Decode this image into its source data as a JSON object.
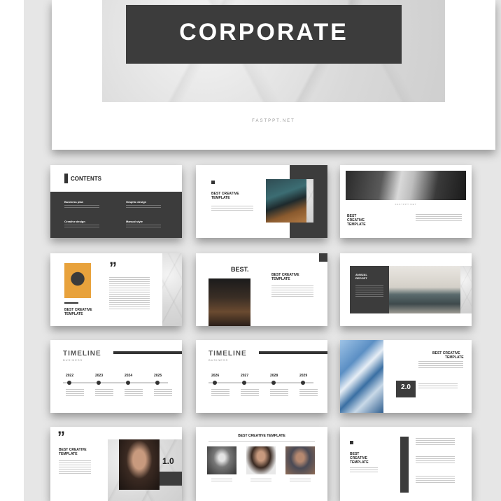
{
  "cover": {
    "title": "CORPORATE",
    "footer": "FASTPPT.NET"
  },
  "slides": {
    "contents": {
      "heading": "CONTENTS",
      "items": [
        "Business plan",
        "Graphic design",
        "Creative design",
        "Manual style"
      ]
    },
    "laptop": {
      "title_line1": "BEST CREATIVE",
      "title_line2": "TEMPLATE"
    },
    "keyboard": {
      "footer": "FASTPPT.NET",
      "title_line1": "BEST",
      "title_line2": "CREATIVE",
      "title_line3": "TEMPLATE"
    },
    "quote": {
      "mark": "”",
      "title_line1": "BEST CREATIVE",
      "title_line2": "TEMPLATE"
    },
    "best": {
      "title": "BEST.",
      "subtitle_line1": "BEST CREATIVE",
      "subtitle_line2": "TEMPLATE"
    },
    "annual": {
      "title_line1": "ANNUAL",
      "title_line2": "REPORT"
    },
    "timeline1": {
      "title": "TIMELINE",
      "subtitle": "BUSINESS",
      "years": [
        "2022",
        "2023",
        "2024",
        "2025"
      ]
    },
    "timeline2": {
      "title": "TIMELINE",
      "subtitle": "BUSINESS",
      "years": [
        "2026",
        "2027",
        "2028",
        "2029"
      ]
    },
    "building": {
      "title_line1": "BEST CREATIVE",
      "title_line2": "TEMPLATE",
      "number": "2.0"
    },
    "portrait": {
      "mark": "”",
      "title_line1": "BEST CREATIVE",
      "title_line2": "TEMPLATE",
      "number": "1.0"
    },
    "team": {
      "heading": "BEST CREATIVE TEMPLATE"
    },
    "last": {
      "title_line1": "BEST",
      "title_line2": "CREATIVE",
      "title_line3": "TEMPLATE"
    }
  }
}
